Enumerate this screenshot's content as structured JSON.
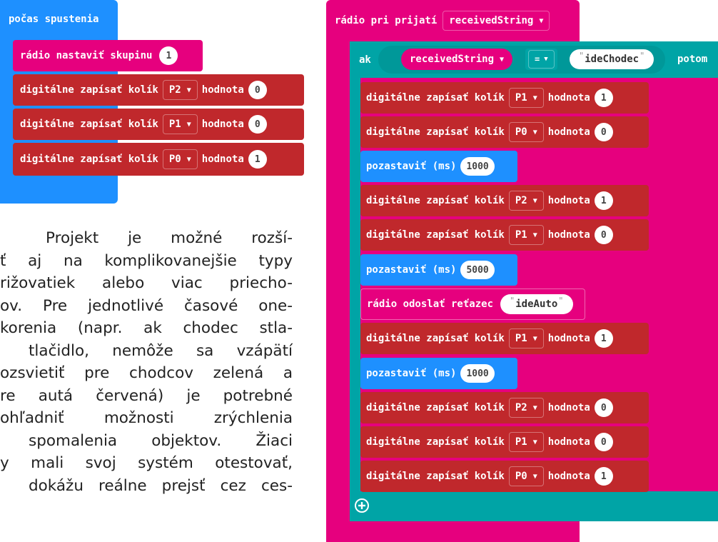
{
  "on_start": {
    "hat_label": "počas spustenia",
    "radio_group": {
      "label": "rádio nastaviť skupinu",
      "value": "1"
    },
    "pin_writes": [
      {
        "label": "digitálne zapísať kolík",
        "pin": "P2",
        "value_label": "hodnota",
        "value": "0"
      },
      {
        "label": "digitálne zapísať kolík",
        "pin": "P1",
        "value_label": "hodnota",
        "value": "0"
      },
      {
        "label": "digitálne zapísať kolík",
        "pin": "P0",
        "value_label": "hodnota",
        "value": "1"
      }
    ]
  },
  "paragraph_lines": [
    "Projekt je možné rozší-",
    "ť aj na komplikovanejšie typy",
    "rižovatiek alebo viac priecho-",
    "ov. Pre jednotlivé časové one-",
    "korenia (napr. ak chodec stla-",
    "tlačidlo, nemôže sa vzápätí",
    "ozsvietiť pre chodcov zelená a",
    "re autá červená) je potrebné",
    "ohľadniť možnosti zrýchlenia",
    "spomalenia objektov. Žiaci",
    "y mali svoj systém otestovať,",
    "dokážu reálne prejsť cez ces-"
  ],
  "on_received": {
    "hat_label": "rádio pri prijatí",
    "hat_param": "receivedString",
    "if_label": "ak",
    "condition": {
      "left": "receivedString",
      "operator": "=",
      "right": "ideChodec"
    },
    "then_label": "potom",
    "body": [
      {
        "kind": "pin",
        "label": "digitálne zapísať kolík",
        "pin": "P1",
        "value_label": "hodnota",
        "value": "1"
      },
      {
        "kind": "pin",
        "label": "digitálne zapísať kolík",
        "pin": "P0",
        "value_label": "hodnota",
        "value": "0"
      },
      {
        "kind": "pause",
        "label": "pozastaviť (ms)",
        "value": "1000"
      },
      {
        "kind": "pin",
        "label": "digitálne zapísať kolík",
        "pin": "P2",
        "value_label": "hodnota",
        "value": "1"
      },
      {
        "kind": "pin",
        "label": "digitálne zapísať kolík",
        "pin": "P1",
        "value_label": "hodnota",
        "value": "0"
      },
      {
        "kind": "pause",
        "label": "pozastaviť (ms)",
        "value": "5000"
      },
      {
        "kind": "send",
        "label": "rádio odoslať reťazec",
        "value": "ideAuto"
      },
      {
        "kind": "pin",
        "label": "digitálne zapísať kolík",
        "pin": "P1",
        "value_label": "hodnota",
        "value": "1"
      },
      {
        "kind": "pause",
        "label": "pozastaviť (ms)",
        "value": "1000"
      },
      {
        "kind": "pin",
        "label": "digitálne zapísať kolík",
        "pin": "P2",
        "value_label": "hodnota",
        "value": "0"
      },
      {
        "kind": "pin",
        "label": "digitálne zapísať kolík",
        "pin": "P1",
        "value_label": "hodnota",
        "value": "0"
      },
      {
        "kind": "pin",
        "label": "digitálne zapísať kolík",
        "pin": "P0",
        "value_label": "hodnota",
        "value": "1"
      }
    ]
  },
  "colors": {
    "events": "#1e90ff",
    "radio": "#e6007e",
    "pins": "#c0282c",
    "basic": "#1e90ff",
    "logic": "#00a4a6"
  },
  "icons": {
    "dropdown": "triangle-down-icon",
    "add": "plus-circle-icon"
  }
}
